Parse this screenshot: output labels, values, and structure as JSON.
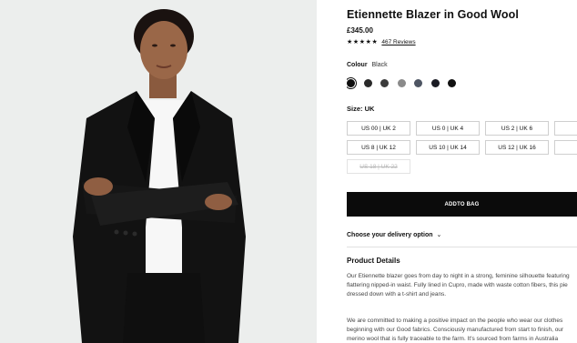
{
  "product": {
    "title": "Etiennette Blazer in Good Wool",
    "price": "£345.00",
    "stars": "★★★★★",
    "reviews_link": "467 Reviews"
  },
  "colour": {
    "label": "Colour",
    "selected": "Black",
    "swatches": [
      {
        "name": "black",
        "hex": "#0e0e0e",
        "selected": true
      },
      {
        "name": "charcoal",
        "hex": "#2a2a2a",
        "selected": false
      },
      {
        "name": "dark-grey",
        "hex": "#3b3b3b",
        "selected": false
      },
      {
        "name": "grey",
        "hex": "#8a8a8a",
        "selected": false
      },
      {
        "name": "slate",
        "hex": "#4e5563",
        "selected": false
      },
      {
        "name": "navy",
        "hex": "#1b1c24",
        "selected": false
      },
      {
        "name": "black-2",
        "hex": "#111111",
        "selected": false
      }
    ]
  },
  "size": {
    "label": "Size: UK",
    "options": [
      {
        "label": "US 00 | UK 2",
        "available": true
      },
      {
        "label": "US 0 | UK 4",
        "available": true
      },
      {
        "label": "US 2 | UK 6",
        "available": true
      },
      {
        "label": "US",
        "available": true
      },
      {
        "label": "US 8 | UK 12",
        "available": true
      },
      {
        "label": "US 10 | UK 14",
        "available": true
      },
      {
        "label": "US 12 | UK 16",
        "available": true
      },
      {
        "label": "US",
        "available": true
      },
      {
        "label": "US 18 | UK 22",
        "available": false
      }
    ]
  },
  "cart": {
    "add_label": "ADDTO BAG"
  },
  "delivery": {
    "label": "Choose your delivery option",
    "chevron": "⌄"
  },
  "details": {
    "heading": "Product Details",
    "para1_lines": [
      "Our Etiennette blazer goes from day to night in a strong, feminine silhouette featuring",
      "flattering nipped-in waist. Fully lined in Cupro, made with waste cotton fibers, this pie",
      "dressed down with a t-shirt and jeans."
    ],
    "para2_lines": [
      "We are committed to making a positive impact on the people who wear our clothes",
      "beginning with our Good fabrics. Consciously manufactured from start to finish, our",
      "merino wool that is fully traceable to the farm. It's sourced from farms in Australia"
    ]
  }
}
